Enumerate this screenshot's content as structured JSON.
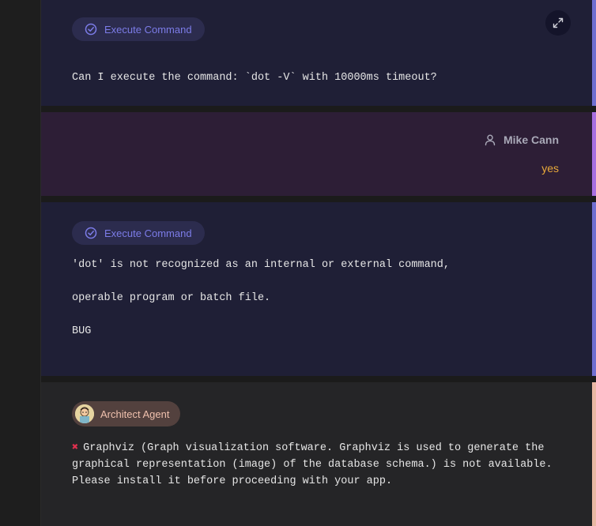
{
  "messages": {
    "cmd1": {
      "badge": "Execute Command",
      "text": "Can I execute the command: `dot -V` with 10000ms timeout?"
    },
    "user1": {
      "author": "Mike Cann",
      "text": "yes"
    },
    "cmd2": {
      "badge": "Execute Command",
      "line1": "'dot' is not recognized as an internal or external command,",
      "line2": "operable program or batch file.",
      "line3": "BUG"
    },
    "arch": {
      "badge": "Architect Agent",
      "line1": "Graphviz (Graph visualization software. Graphviz is used to generate the",
      "line2": "graphical representation (image) of the database schema.) is not available.",
      "line3": "Please install it before proceeding with your app."
    }
  },
  "icons": {
    "badge_icon": "check-circle-icon",
    "expand_icon": "expand-icon",
    "user_icon": "user-icon",
    "error_icon": "cross-mark-icon"
  },
  "colors": {
    "agent_accent": "#6f6fd0",
    "user_accent": "#a86fe0",
    "architect_accent": "#e9b8a4",
    "reply_text": "#e8a93a",
    "error_mark": "#e0304e"
  }
}
